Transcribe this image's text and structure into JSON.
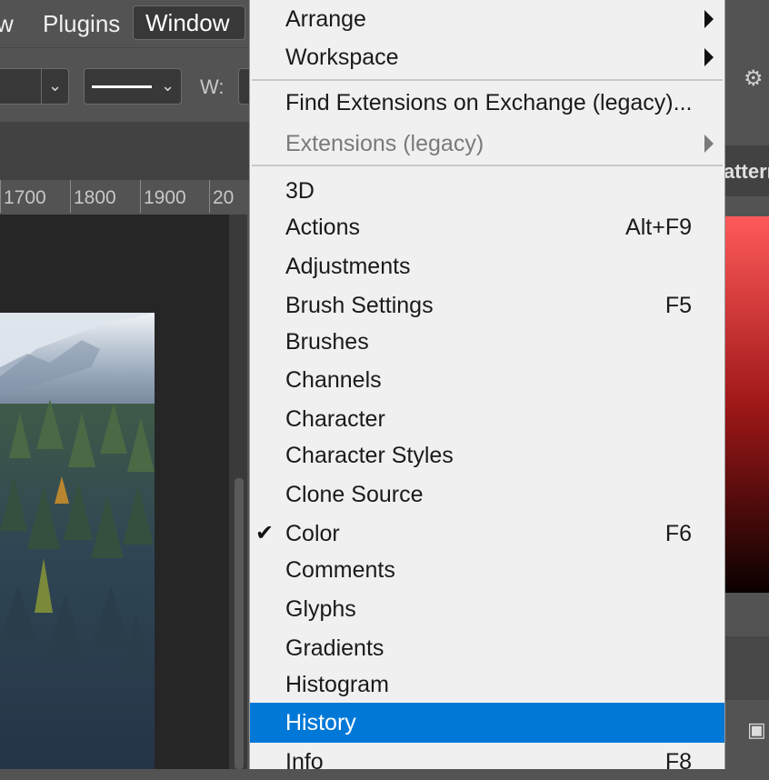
{
  "menubar": {
    "items": [
      "w",
      "Plugins",
      "Window"
    ]
  },
  "options": {
    "width_label": "W:"
  },
  "ruler": {
    "labels": [
      "1700",
      "1800",
      "1900",
      "20"
    ]
  },
  "right_panel": {
    "tab_label": "attern"
  },
  "window_menu": {
    "items": [
      {
        "label": "Arrange",
        "submenu": true
      },
      {
        "label": "Workspace",
        "submenu": true
      },
      {
        "label": "Find Extensions on Exchange (legacy)..."
      },
      {
        "label": "Extensions (legacy)",
        "submenu": true,
        "disabled": true
      },
      {
        "label": "3D"
      },
      {
        "label": "Actions",
        "shortcut": "Alt+F9"
      },
      {
        "label": "Adjustments"
      },
      {
        "label": "Brush Settings",
        "shortcut": "F5"
      },
      {
        "label": "Brushes"
      },
      {
        "label": "Channels"
      },
      {
        "label": "Character"
      },
      {
        "label": "Character Styles"
      },
      {
        "label": "Clone Source"
      },
      {
        "label": "Color",
        "shortcut": "F6",
        "checked": true
      },
      {
        "label": "Comments"
      },
      {
        "label": "Glyphs"
      },
      {
        "label": "Gradients"
      },
      {
        "label": "Histogram"
      },
      {
        "label": "History",
        "highlighted": true
      },
      {
        "label": "Info",
        "shortcut": "F8"
      }
    ],
    "check_glyph": "✔"
  },
  "colors": {
    "highlight": "#0078d7",
    "menu_bg": "#f0f0f0",
    "app_bg": "#535353"
  }
}
